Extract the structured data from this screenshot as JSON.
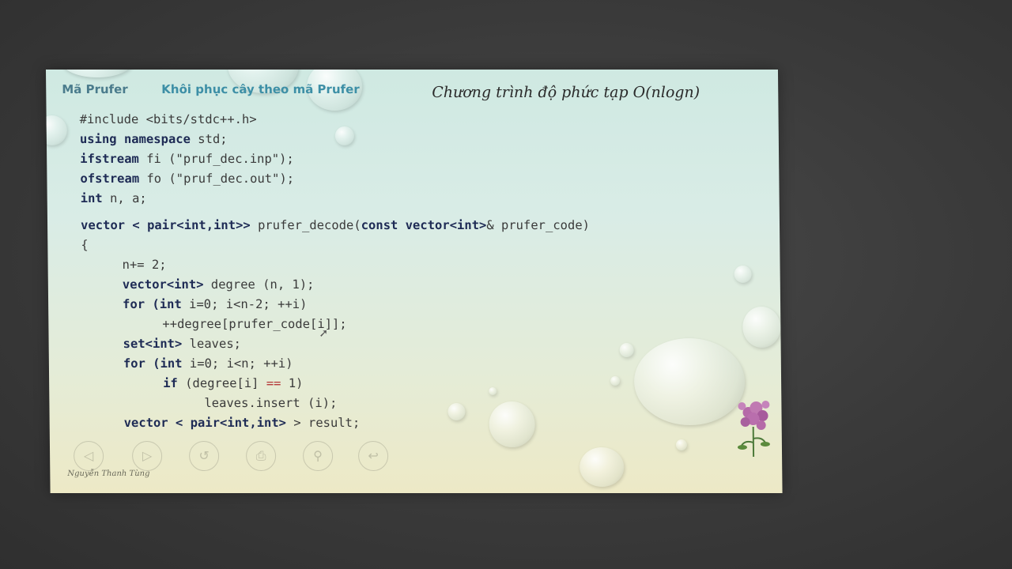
{
  "nav": {
    "item1": "Mã Prufer",
    "item2": "Khôi phục cây theo mã Prufer"
  },
  "slide_title": "Chương trình độ phức tạp O(nlogn)",
  "code": {
    "l1": "#include <bits/stdc++.h>",
    "l2a": "using namespace",
    "l2b": " std;",
    "l3a": "ifstream",
    "l3b": " fi (\"pruf_dec.inp\");",
    "l4a": "ofstream",
    "l4b": " fo (\"pruf_dec.out\");",
    "l5a": "int",
    "l5b": " n, a;",
    "l6a": "vector < pair<int,int>>",
    "l6b": " prufer_decode(",
    "l6c": "const vector<int>",
    "l6d": "& prufer_code)",
    "l7": "{",
    "l8": "n+= 2;",
    "l9a": "vector<int>",
    "l9b": " degree (n, 1);",
    "l10a": "for (int",
    "l10b": " i=0; i<n-2; ++i)",
    "l11": "++degree[prufer_code[i]];",
    "l12a": "set<int>",
    "l12b": " leaves;",
    "l13a": "for (int",
    "l13b": " i=0; i<n; ++i)",
    "l14a": "if",
    "l14b": " (degree[i] ",
    "l14c": "==",
    "l14d": " 1)",
    "l15": "leaves.insert (i);",
    "l16a": "vector < pair<int,int>",
    "l16b": " > result;"
  },
  "author": "Nguyễn Thanh Tùng",
  "controls": {
    "prev": "◁",
    "play": "▷",
    "rewind": "↺",
    "print": "⎙",
    "zoom": "⚲",
    "exit": "↩"
  },
  "colors": {
    "keyword": "#1e2b55",
    "operator": "#b53a3a",
    "nav_link": "#3d8fa6"
  }
}
